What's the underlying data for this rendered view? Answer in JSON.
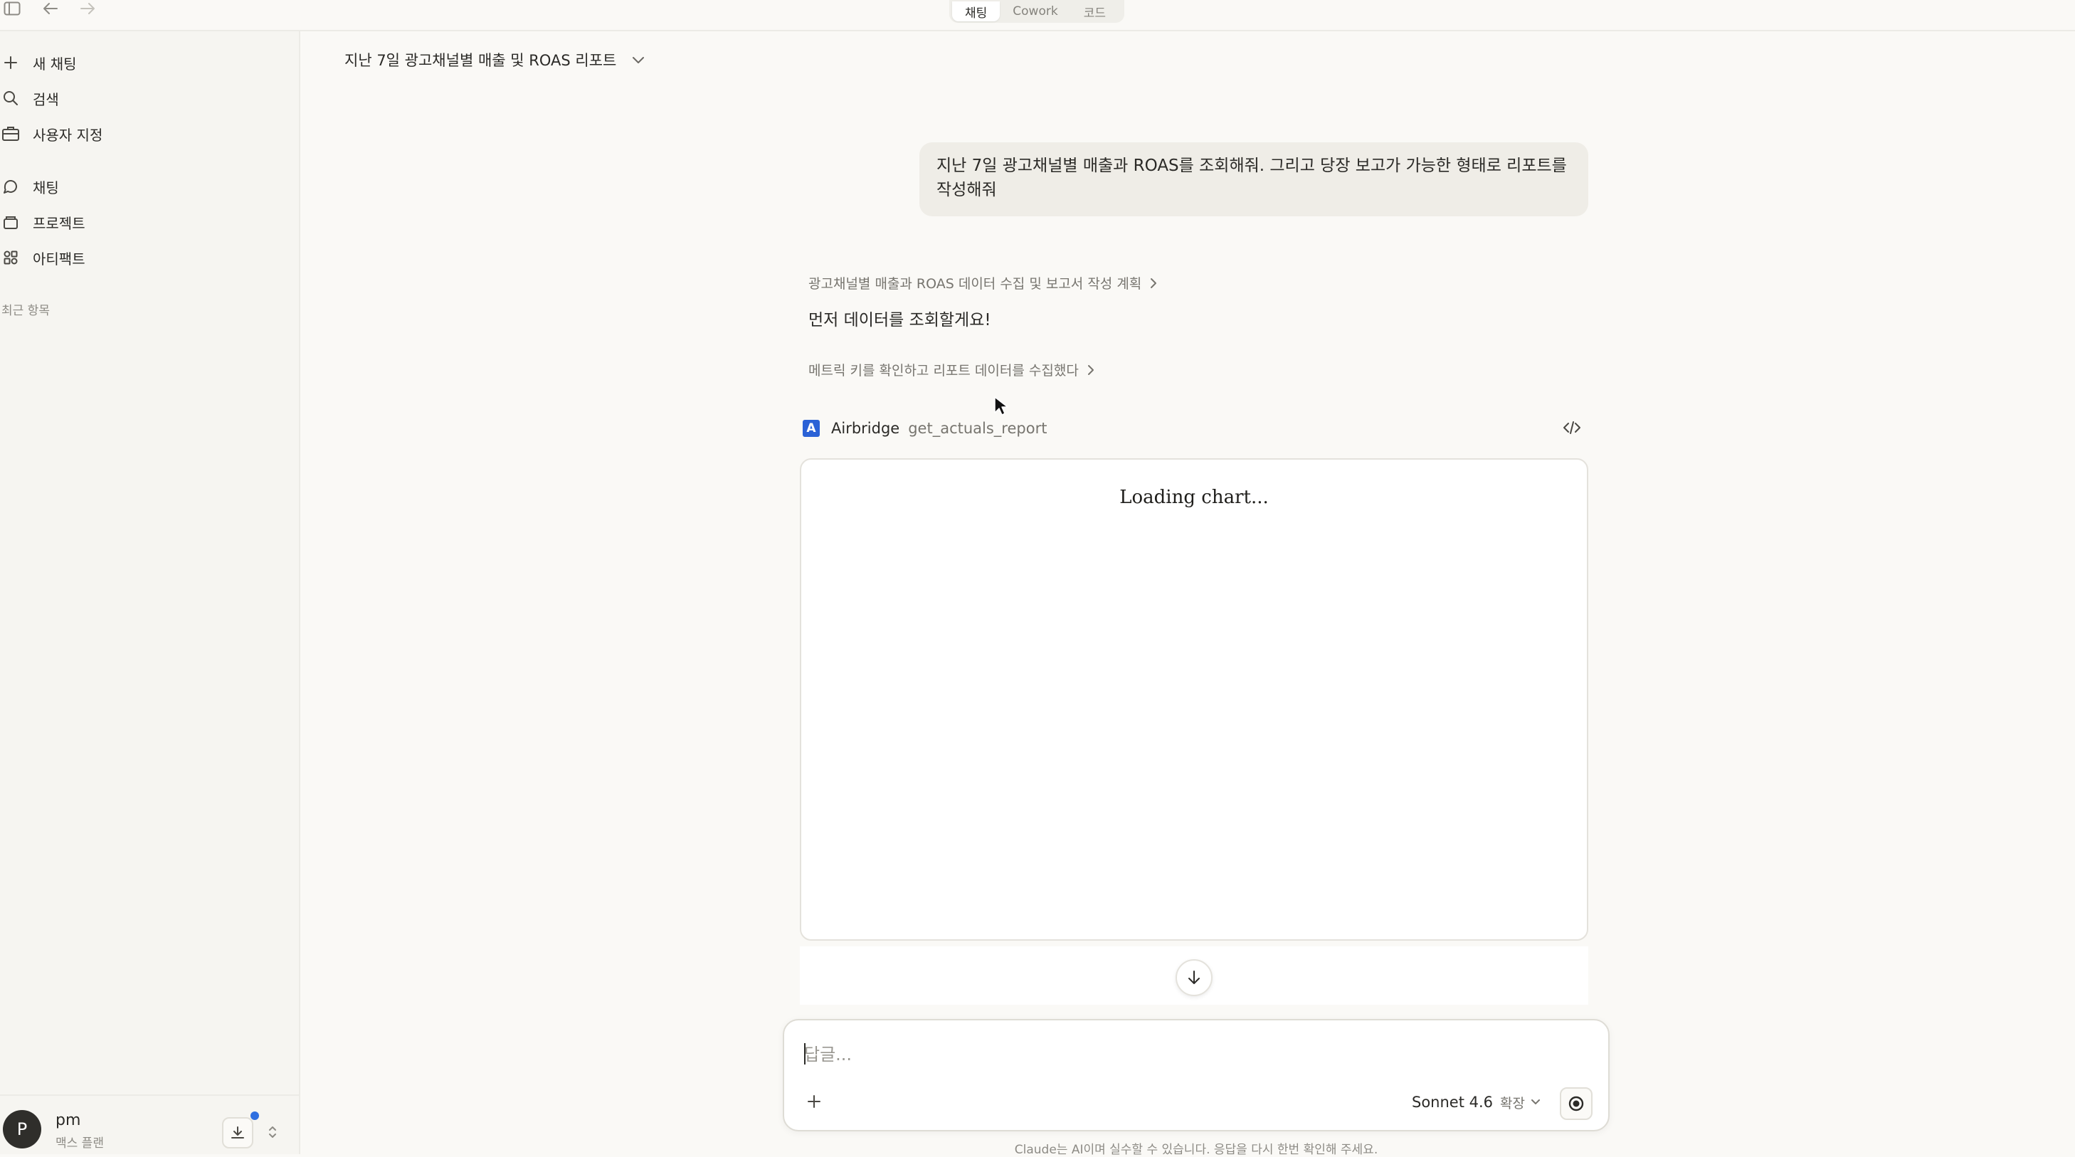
{
  "topbar": {
    "tabs": [
      {
        "label": "채팅",
        "active": true
      },
      {
        "label": "Cowork",
        "active": false
      },
      {
        "label": "코드",
        "active": false
      }
    ]
  },
  "sidebar": {
    "items": [
      {
        "label": "새 채팅",
        "icon": "plus-icon"
      },
      {
        "label": "검색",
        "icon": "search-icon"
      },
      {
        "label": "사용자 지정",
        "icon": "briefcase-icon"
      },
      {
        "label": "채팅",
        "icon": "chat-bubble-icon"
      },
      {
        "label": "프로젝트",
        "icon": "folder-stack-icon"
      },
      {
        "label": "아티팩트",
        "icon": "artifacts-grid-icon"
      }
    ],
    "recent_label": "최근 항목",
    "user": {
      "avatar_letter": "P",
      "name": "pm",
      "plan": "맥스 플랜"
    }
  },
  "conversation": {
    "title": "지난 7일 광고채널별 매출 및 ROAS 리포트",
    "user_message": "지난 7일 광고채널별 매출과 ROAS를 조회해줘. 그리고 당장 보고가 가능한 형태로 리포트를 작성해줘",
    "thought_1": "광고채널별 매출과 ROAS 데이터 수집 및 보고서 작성 계획",
    "assistant_text": "먼저 데이터를 조회할게요!",
    "thought_2": "메트릭 키를 확인하고 리포트 데이터를 수집했다",
    "tool": {
      "logo_letter": "A",
      "name": "Airbridge",
      "function": "get_actuals_report"
    },
    "chart_loading": "Loading chart..."
  },
  "composer": {
    "placeholder": "답글...",
    "model": "Sonnet 4.6",
    "model_mode": "확장"
  },
  "disclaimer": "Claude는 AI이며 실수할 수 있습니다. 응답을 다시 한번 확인해 주세요.",
  "colors": {
    "accent_blue": "#2b62d6",
    "notification_dot": "#2f6fe0",
    "background": "#faf9f6"
  }
}
